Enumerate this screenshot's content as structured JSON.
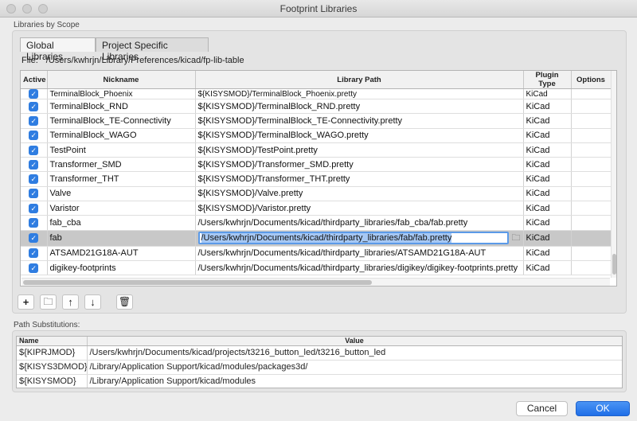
{
  "window": {
    "title": "Footprint Libraries"
  },
  "scope_group": {
    "label": "Libraries by Scope"
  },
  "tabs": [
    {
      "label": "Global Libraries"
    },
    {
      "label": "Project Specific Libraries"
    }
  ],
  "file": {
    "label": "File:",
    "path": "/Users/kwhrjn/Library/Preferences/kicad/fp-lib-table"
  },
  "lib_table": {
    "headers": {
      "active": "Active",
      "nickname": "Nickname",
      "path": "Library Path",
      "plugin": "Plugin Type",
      "options": "Options"
    },
    "check_glyph": "✓",
    "rows": [
      {
        "nickname": "TerminalBlock_Phoenix",
        "path": "${KISYSMOD}/TerminalBlock_Phoenix.pretty",
        "plugin": "KiCad"
      },
      {
        "nickname": "TerminalBlock_RND",
        "path": "${KISYSMOD}/TerminalBlock_RND.pretty",
        "plugin": "KiCad"
      },
      {
        "nickname": "TerminalBlock_TE-Connectivity",
        "path": "${KISYSMOD}/TerminalBlock_TE-Connectivity.pretty",
        "plugin": "KiCad"
      },
      {
        "nickname": "TerminalBlock_WAGO",
        "path": "${KISYSMOD}/TerminalBlock_WAGO.pretty",
        "plugin": "KiCad"
      },
      {
        "nickname": "TestPoint",
        "path": "${KISYSMOD}/TestPoint.pretty",
        "plugin": "KiCad"
      },
      {
        "nickname": "Transformer_SMD",
        "path": "${KISYSMOD}/Transformer_SMD.pretty",
        "plugin": "KiCad"
      },
      {
        "nickname": "Transformer_THT",
        "path": "${KISYSMOD}/Transformer_THT.pretty",
        "plugin": "KiCad"
      },
      {
        "nickname": "Valve",
        "path": "${KISYSMOD}/Valve.pretty",
        "plugin": "KiCad"
      },
      {
        "nickname": "Varistor",
        "path": "${KISYSMOD}/Varistor.pretty",
        "plugin": "KiCad"
      },
      {
        "nickname": "fab_cba",
        "path": "/Users/kwhrjn/Documents/kicad/thirdparty_libraries/fab_cba/fab.pretty",
        "plugin": "KiCad"
      },
      {
        "nickname": "fab",
        "path": "/Users/kwhrjn/Documents/kicad/thirdparty_libraries/fab/fab.pretty",
        "plugin": "KiCad"
      },
      {
        "nickname": "ATSAMD21G18A-AUT",
        "path": "/Users/kwhrjn/Documents/kicad/thirdparty_libraries/ATSAMD21G18A-AUT",
        "plugin": "KiCad"
      },
      {
        "nickname": "digikey-footprints",
        "path": "/Users/kwhrjn/Documents/kicad/thirdparty_libraries/digikey/digikey-footprints.pretty",
        "plugin": "KiCad"
      }
    ]
  },
  "toolbar": {
    "add": "+",
    "browse": "🗀",
    "up": "↑",
    "down": "↓",
    "delete": "🗑"
  },
  "subs": {
    "label": "Path Substitutions:",
    "headers": {
      "name": "Name",
      "value": "Value"
    },
    "rows": [
      {
        "name": "${KIPRJMOD}",
        "value": "/Users/kwhrjn/Documents/kicad/projects/t3216_button_led/t3216_button_led"
      },
      {
        "name": "${KISYS3DMOD}",
        "value": "/Library/Application Support/kicad/modules/packages3d/"
      },
      {
        "name": "${KISYSMOD}",
        "value": "/Library/Application Support/kicad/modules"
      }
    ]
  },
  "buttons": {
    "cancel": "Cancel",
    "ok": "OK"
  }
}
